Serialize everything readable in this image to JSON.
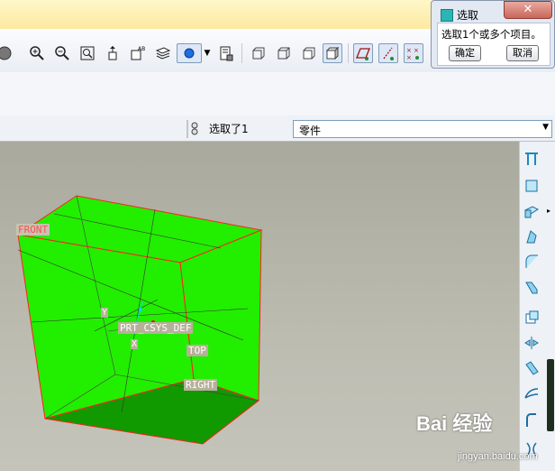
{
  "toolbar": {
    "buttons": [
      "sphere-shade-icon",
      "zoom-in-icon",
      "zoom-out-icon",
      "zoom-fit-icon",
      "spin-center-icon",
      "annotation-icon",
      "layers-icon",
      "display-style-icon",
      "model-tree-icon",
      "view-front-icon",
      "view-back-icon",
      "view-left-icon",
      "shaded-icon",
      "plane-display-icon",
      "axis-display-icon",
      "csys-display-icon"
    ]
  },
  "status": {
    "selected_text": "选取了1",
    "filter_value": "零件"
  },
  "dialog": {
    "title": "选取",
    "message": "选取1个或多个项目。",
    "ok_label": "确定",
    "cancel_label": "取消",
    "close_glyph": "✕"
  },
  "viewport": {
    "labels": {
      "front": "FRONT",
      "csys": "PRT_CSYS_DEF",
      "top": "TOP",
      "right": "RIGHT",
      "axis_y": "Y",
      "axis_x": "X"
    },
    "colors": {
      "part_face": "#22ee00",
      "part_bottom": "#119900",
      "edge": "#ff2020"
    }
  },
  "watermark": {
    "brand": "Bai 经验",
    "url": "jingyan.baidu.com"
  }
}
